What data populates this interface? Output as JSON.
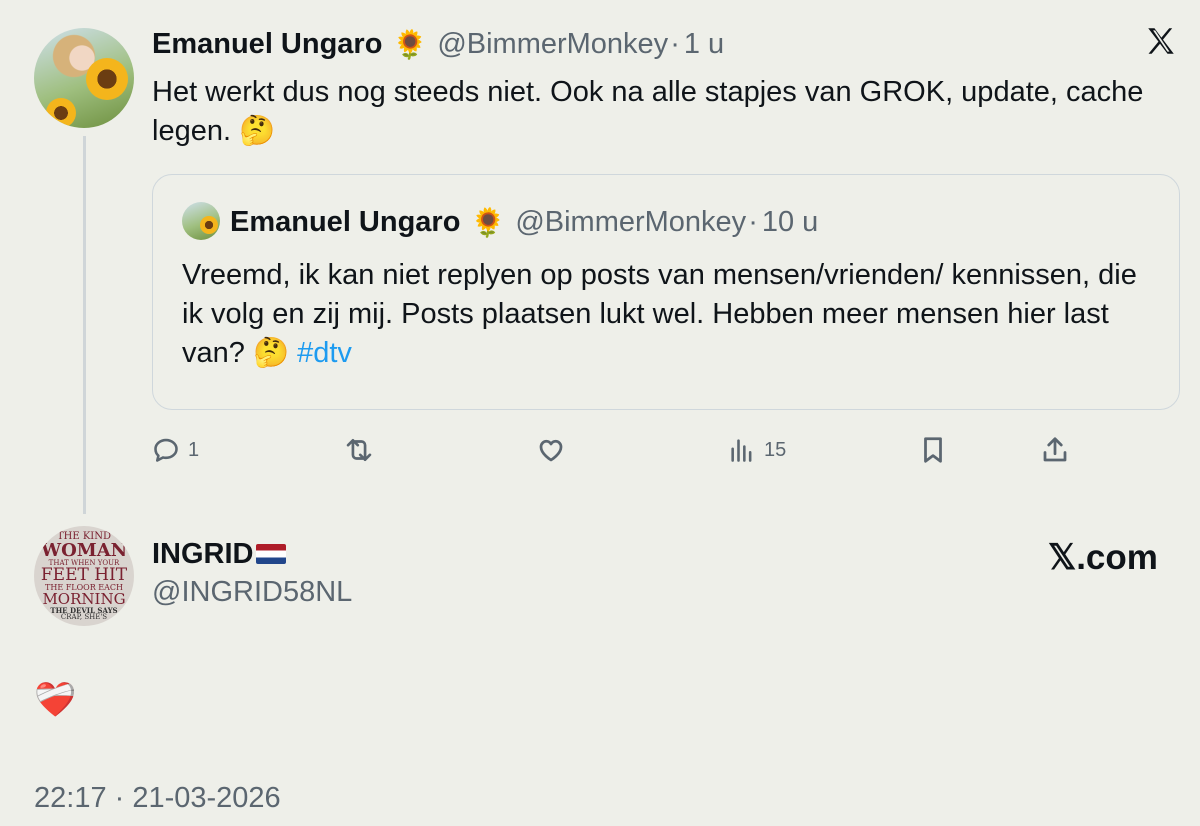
{
  "post": {
    "author_name": "Emanuel Ungaro",
    "author_emoji": "🌻",
    "handle": "@BimmerMonkey",
    "separator": "·",
    "time": "1 u",
    "text": "Het werkt dus nog steeds niet. Ook na alle stapjes van GROK, update, cache legen. 🤔",
    "close_label": "𝕏"
  },
  "quoted": {
    "author_name": "Emanuel Ungaro",
    "author_emoji": "🌻",
    "handle": "@BimmerMonkey",
    "separator": "·",
    "time": "10 u",
    "text": "Vreemd, ik kan niet replyen op posts van mensen/vrienden/ kennissen, die ik volg en zij mij. Posts plaatsen lukt wel. Hebben meer mensen hier last van? 🤔 ",
    "hashtag": "#dtv"
  },
  "actions": {
    "reply_count": "1",
    "views_count": "15"
  },
  "reply": {
    "author_name": "INGRID",
    "handle": "@INGRID58NL",
    "brand": "𝕏.com",
    "text": "❤️‍🩹",
    "timestamp": "22:17 · 21-03-2026",
    "avatar_lines": [
      "THE KIND",
      "WOMAN",
      "THAT WHEN YOUR",
      "FEET HIT",
      "THE FLOOR EACH",
      "MORNING",
      "THE DEVIL SAYS",
      "CRAP, SHE'S"
    ]
  }
}
